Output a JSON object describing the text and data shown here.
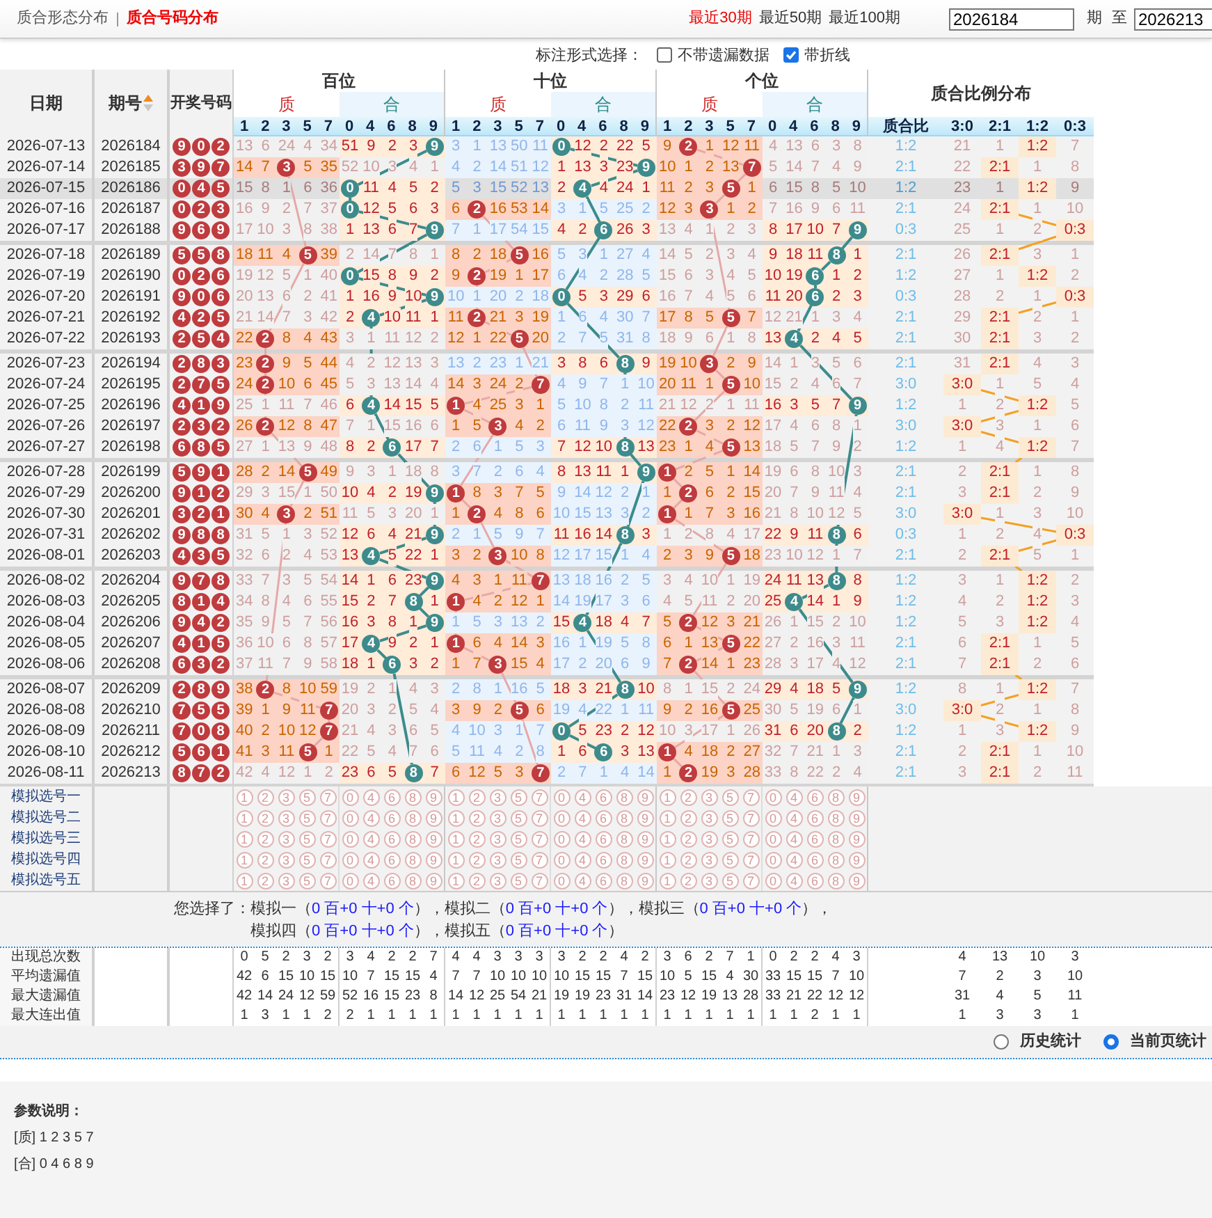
{
  "top_bar": {
    "tabs": [
      {
        "label": "质合形态分布",
        "selected": false
      },
      {
        "label": "质合号码分布",
        "selected": true
      }
    ],
    "periods": [
      {
        "label": "最近30期",
        "selected": true
      },
      {
        "label": "最近50期",
        "selected": false
      },
      {
        "label": "最近100期",
        "selected": false
      }
    ],
    "from_value": "2026184",
    "from_unit": "期",
    "to_label": "至",
    "to_value": "2026213"
  },
  "options": {
    "label": "标注形式选择：",
    "checkboxes": [
      {
        "label": "不带遗漏数据",
        "checked": false
      },
      {
        "label": "带折线",
        "checked": true
      }
    ]
  },
  "header": {
    "date": "日期",
    "issue": "期号",
    "draw": "开奖号码",
    "positions": [
      {
        "label": "百位",
        "groups": [
          {
            "label": "质",
            "kind": "prime",
            "digits": [
              "1",
              "2",
              "3",
              "5",
              "7"
            ]
          },
          {
            "label": "合",
            "kind": "composite",
            "digits": [
              "0",
              "4",
              "6",
              "8",
              "9"
            ]
          }
        ]
      },
      {
        "label": "十位",
        "groups": [
          {
            "label": "质",
            "kind": "prime",
            "digits": [
              "1",
              "2",
              "3",
              "5",
              "7"
            ]
          },
          {
            "label": "合",
            "kind": "composite",
            "digits": [
              "0",
              "4",
              "6",
              "8",
              "9"
            ]
          }
        ]
      },
      {
        "label": "个位",
        "groups": [
          {
            "label": "质",
            "kind": "prime",
            "digits": [
              "1",
              "2",
              "3",
              "5",
              "7"
            ]
          },
          {
            "label": "合",
            "kind": "composite",
            "digits": [
              "0",
              "4",
              "6",
              "8",
              "9"
            ]
          }
        ]
      }
    ],
    "ratio": {
      "label": "质合比例分布",
      "columns": [
        "质合比",
        "3:0",
        "2:1",
        "1:2",
        "0:3"
      ]
    }
  },
  "rows": [
    {
      "date": "2026-07-13",
      "issue": "2026184",
      "draw": [
        "9",
        "0",
        "2"
      ],
      "highlighted": false,
      "cells": [
        "13",
        "6",
        "24",
        "4",
        "34",
        "51",
        "9",
        "2",
        "3",
        {
          "ball": "9"
        },
        "3",
        "1",
        "13",
        "50",
        "11",
        {
          "ball": "0"
        },
        "12",
        "2",
        "22",
        "5",
        "9",
        {
          "ball": "2"
        },
        "1",
        "12",
        "11",
        "4",
        "13",
        "6",
        "3",
        "8"
      ],
      "ratio": "1:2",
      "ratio_cells": [
        "21",
        "1",
        {
          "hit": "1:2"
        },
        "7"
      ]
    },
    {
      "date": "2026-07-14",
      "issue": "2026185",
      "draw": [
        "3",
        "9",
        "7"
      ],
      "highlighted": false,
      "cells": [
        "14",
        "7",
        {
          "ball": "3"
        },
        "5",
        "35",
        "52",
        "10",
        "3",
        "4",
        "1",
        "4",
        "2",
        "14",
        "51",
        "12",
        "1",
        "13",
        "3",
        "23",
        {
          "ball": "9"
        },
        "10",
        "1",
        "2",
        "13",
        {
          "ball": "7"
        },
        "5",
        "14",
        "7",
        "4",
        "9"
      ],
      "ratio": "2:1",
      "ratio_cells": [
        "22",
        {
          "hit": "2:1"
        },
        "1",
        "8"
      ]
    },
    {
      "date": "2026-07-15",
      "issue": "2026186",
      "draw": [
        "0",
        "4",
        "5"
      ],
      "highlighted": true,
      "cells": [
        "15",
        "8",
        "1",
        "6",
        "36",
        {
          "ball": "0"
        },
        "11",
        "4",
        "5",
        "2",
        "5",
        "3",
        "15",
        "52",
        "13",
        "2",
        {
          "ball": "4"
        },
        "4",
        "24",
        "1",
        "11",
        "2",
        "3",
        {
          "ball": "5"
        },
        "1",
        "6",
        "15",
        "8",
        "5",
        "10"
      ],
      "ratio": "1:2",
      "ratio_cells": [
        "23",
        "1",
        {
          "hit": "1:2"
        },
        "9"
      ]
    },
    {
      "date": "2026-07-16",
      "issue": "2026187",
      "draw": [
        "0",
        "2",
        "3"
      ],
      "highlighted": false,
      "cells": [
        "16",
        "9",
        "2",
        "7",
        "37",
        {
          "ball": "0"
        },
        "12",
        "5",
        "6",
        "3",
        "6",
        {
          "ball": "2"
        },
        "16",
        "53",
        "14",
        "3",
        "1",
        "5",
        "25",
        "2",
        "12",
        "3",
        {
          "ball": "3"
        },
        "1",
        "2",
        "7",
        "16",
        "9",
        "6",
        "11"
      ],
      "ratio": "2:1",
      "ratio_cells": [
        "24",
        {
          "hit": "2:1"
        },
        "1",
        "10"
      ]
    },
    {
      "date": "2026-07-17",
      "issue": "2026188",
      "draw": [
        "9",
        "6",
        "9"
      ],
      "highlighted": false,
      "cells": [
        "17",
        "10",
        "3",
        "8",
        "38",
        "1",
        "13",
        "6",
        "7",
        {
          "ball": "9"
        },
        "7",
        "1",
        "17",
        "54",
        "15",
        "4",
        "2",
        {
          "ball": "6"
        },
        "26",
        "3",
        "13",
        "4",
        "1",
        "2",
        "3",
        "8",
        "17",
        "10",
        "7",
        {
          "ball": "9"
        }
      ],
      "ratio": "0:3",
      "ratio_cells": [
        "25",
        "1",
        "2",
        {
          "hit": "0:3"
        }
      ]
    },
    {
      "date": "2026-07-18",
      "issue": "2026189",
      "draw": [
        "5",
        "5",
        "8"
      ],
      "highlighted": false,
      "cells": [
        "18",
        "11",
        "4",
        {
          "ball": "5"
        },
        "39",
        "2",
        "14",
        "7",
        "8",
        "1",
        "8",
        "2",
        "18",
        {
          "ball": "5"
        },
        "16",
        "5",
        "3",
        "1",
        "27",
        "4",
        "14",
        "5",
        "2",
        "3",
        "4",
        "9",
        "18",
        "11",
        {
          "ball": "8"
        },
        "1"
      ],
      "ratio": "2:1",
      "ratio_cells": [
        "26",
        {
          "hit": "2:1"
        },
        "3",
        "1"
      ]
    },
    {
      "date": "2026-07-19",
      "issue": "2026190",
      "draw": [
        "0",
        "2",
        "6"
      ],
      "highlighted": false,
      "cells": [
        "19",
        "12",
        "5",
        "1",
        "40",
        {
          "ball": "0"
        },
        "15",
        "8",
        "9",
        "2",
        "9",
        {
          "ball": "2"
        },
        "19",
        "1",
        "17",
        "6",
        "4",
        "2",
        "28",
        "5",
        "15",
        "6",
        "3",
        "4",
        "5",
        "10",
        "19",
        {
          "ball": "6"
        },
        "1",
        "2"
      ],
      "ratio": "1:2",
      "ratio_cells": [
        "27",
        "1",
        {
          "hit": "1:2"
        },
        "2"
      ]
    },
    {
      "date": "2026-07-20",
      "issue": "2026191",
      "draw": [
        "9",
        "0",
        "6"
      ],
      "highlighted": false,
      "cells": [
        "20",
        "13",
        "6",
        "2",
        "41",
        "1",
        "16",
        "9",
        "10",
        {
          "ball": "9"
        },
        "10",
        "1",
        "20",
        "2",
        "18",
        {
          "ball": "0"
        },
        "5",
        "3",
        "29",
        "6",
        "16",
        "7",
        "4",
        "5",
        "6",
        "11",
        "20",
        {
          "ball": "6"
        },
        "2",
        "3"
      ],
      "ratio": "0:3",
      "ratio_cells": [
        "28",
        "2",
        "1",
        {
          "hit": "0:3"
        }
      ]
    },
    {
      "date": "2026-07-21",
      "issue": "2026192",
      "draw": [
        "4",
        "2",
        "5"
      ],
      "highlighted": false,
      "cells": [
        "21",
        "14",
        "7",
        "3",
        "42",
        "2",
        {
          "ball": "4"
        },
        "10",
        "11",
        "1",
        "11",
        {
          "ball": "2"
        },
        "21",
        "3",
        "19",
        "1",
        "6",
        "4",
        "30",
        "7",
        "17",
        "8",
        "5",
        {
          "ball": "5"
        },
        "7",
        "12",
        "21",
        "1",
        "3",
        "4"
      ],
      "ratio": "2:1",
      "ratio_cells": [
        "29",
        {
          "hit": "2:1"
        },
        "2",
        "1"
      ]
    },
    {
      "date": "2026-07-22",
      "issue": "2026193",
      "draw": [
        "2",
        "5",
        "4"
      ],
      "highlighted": false,
      "cells": [
        "22",
        {
          "ball": "2"
        },
        "8",
        "4",
        "43",
        "3",
        "1",
        "11",
        "12",
        "2",
        "12",
        "1",
        "22",
        {
          "ball": "5"
        },
        "20",
        "2",
        "7",
        "5",
        "31",
        "8",
        "18",
        "9",
        "6",
        "1",
        "8",
        "13",
        {
          "ball": "4"
        },
        "2",
        "4",
        "5"
      ],
      "ratio": "2:1",
      "ratio_cells": [
        "30",
        {
          "hit": "2:1"
        },
        "3",
        "2"
      ]
    },
    {
      "date": "2026-07-23",
      "issue": "2026194",
      "draw": [
        "2",
        "8",
        "3"
      ],
      "highlighted": false,
      "cells": [
        "23",
        {
          "ball": "2"
        },
        "9",
        "5",
        "44",
        "4",
        "2",
        "12",
        "13",
        "3",
        "13",
        "2",
        "23",
        "1",
        "21",
        "3",
        "8",
        "6",
        {
          "ball": "8"
        },
        "9",
        "19",
        "10",
        {
          "ball": "3"
        },
        "2",
        "9",
        "14",
        "1",
        "3",
        "5",
        "6"
      ],
      "ratio": "2:1",
      "ratio_cells": [
        "31",
        {
          "hit": "2:1"
        },
        "4",
        "3"
      ]
    },
    {
      "date": "2026-07-24",
      "issue": "2026195",
      "draw": [
        "2",
        "7",
        "5"
      ],
      "highlighted": false,
      "cells": [
        "24",
        {
          "ball": "2"
        },
        "10",
        "6",
        "45",
        "5",
        "3",
        "13",
        "14",
        "4",
        "14",
        "3",
        "24",
        "2",
        {
          "ball": "7"
        },
        "4",
        "9",
        "7",
        "1",
        "10",
        "20",
        "11",
        "1",
        {
          "ball": "5"
        },
        "10",
        "15",
        "2",
        "4",
        "6",
        "7"
      ],
      "ratio": "3:0",
      "ratio_cells": [
        {
          "hit": "3:0"
        },
        "1",
        "5",
        "4"
      ]
    },
    {
      "date": "2026-07-25",
      "issue": "2026196",
      "draw": [
        "4",
        "1",
        "9"
      ],
      "highlighted": false,
      "cells": [
        "25",
        "1",
        "11",
        "7",
        "46",
        "6",
        {
          "ball": "4"
        },
        "14",
        "15",
        "5",
        {
          "ball": "1"
        },
        "4",
        "25",
        "3",
        "1",
        "5",
        "10",
        "8",
        "2",
        "11",
        "21",
        "12",
        "2",
        "1",
        "11",
        "16",
        "3",
        "5",
        "7",
        {
          "ball": "9"
        }
      ],
      "ratio": "1:2",
      "ratio_cells": [
        "1",
        "2",
        {
          "hit": "1:2"
        },
        "5"
      ]
    },
    {
      "date": "2026-07-26",
      "issue": "2026197",
      "draw": [
        "2",
        "3",
        "2"
      ],
      "highlighted": false,
      "cells": [
        "26",
        {
          "ball": "2"
        },
        "12",
        "8",
        "47",
        "7",
        "1",
        "15",
        "16",
        "6",
        "1",
        "5",
        {
          "ball": "3"
        },
        "4",
        "2",
        "6",
        "11",
        "9",
        "3",
        "12",
        "22",
        {
          "ball": "2"
        },
        "3",
        "2",
        "12",
        "17",
        "4",
        "6",
        "8",
        "1"
      ],
      "ratio": "3:0",
      "ratio_cells": [
        {
          "hit": "3:0"
        },
        "3",
        "1",
        "6"
      ]
    },
    {
      "date": "2026-07-27",
      "issue": "2026198",
      "draw": [
        "6",
        "8",
        "5"
      ],
      "highlighted": false,
      "cells": [
        "27",
        "1",
        "13",
        "9",
        "48",
        "8",
        "2",
        {
          "ball": "6"
        },
        "17",
        "7",
        "2",
        "6",
        "1",
        "5",
        "3",
        "7",
        "12",
        "10",
        {
          "ball": "8"
        },
        "13",
        "23",
        "1",
        "4",
        {
          "ball": "5"
        },
        "13",
        "18",
        "5",
        "7",
        "9",
        "2"
      ],
      "ratio": "1:2",
      "ratio_cells": [
        "1",
        "4",
        {
          "hit": "1:2"
        },
        "7"
      ]
    },
    {
      "date": "2026-07-28",
      "issue": "2026199",
      "draw": [
        "5",
        "9",
        "1"
      ],
      "highlighted": false,
      "cells": [
        "28",
        "2",
        "14",
        {
          "ball": "5"
        },
        "49",
        "9",
        "3",
        "1",
        "18",
        "8",
        "3",
        "7",
        "2",
        "6",
        "4",
        "8",
        "13",
        "11",
        "1",
        {
          "ball": "9"
        },
        {
          "ball": "1"
        },
        "2",
        "5",
        "1",
        "14",
        "19",
        "6",
        "8",
        "10",
        "3"
      ],
      "ratio": "2:1",
      "ratio_cells": [
        "2",
        {
          "hit": "2:1"
        },
        "1",
        "8"
      ]
    },
    {
      "date": "2026-07-29",
      "issue": "2026200",
      "draw": [
        "9",
        "1",
        "2"
      ],
      "highlighted": false,
      "cells": [
        "29",
        "3",
        "15",
        "1",
        "50",
        "10",
        "4",
        "2",
        "19",
        {
          "ball": "9"
        },
        {
          "ball": "1"
        },
        "8",
        "3",
        "7",
        "5",
        "9",
        "14",
        "12",
        "2",
        "1",
        "1",
        {
          "ball": "2"
        },
        "6",
        "2",
        "15",
        "20",
        "7",
        "9",
        "11",
        "4"
      ],
      "ratio": "2:1",
      "ratio_cells": [
        "3",
        {
          "hit": "2:1"
        },
        "2",
        "9"
      ]
    },
    {
      "date": "2026-07-30",
      "issue": "2026201",
      "draw": [
        "3",
        "2",
        "1"
      ],
      "highlighted": false,
      "cells": [
        "30",
        "4",
        {
          "ball": "3"
        },
        "2",
        "51",
        "11",
        "5",
        "3",
        "20",
        "1",
        "1",
        {
          "ball": "2"
        },
        "4",
        "8",
        "6",
        "10",
        "15",
        "13",
        "3",
        "2",
        {
          "ball": "1"
        },
        "1",
        "7",
        "3",
        "16",
        "21",
        "8",
        "10",
        "12",
        "5"
      ],
      "ratio": "3:0",
      "ratio_cells": [
        {
          "hit": "3:0"
        },
        "1",
        "3",
        "10"
      ]
    },
    {
      "date": "2026-07-31",
      "issue": "2026202",
      "draw": [
        "9",
        "8",
        "8"
      ],
      "highlighted": false,
      "cells": [
        "31",
        "5",
        "1",
        "3",
        "52",
        "12",
        "6",
        "4",
        "21",
        {
          "ball": "9"
        },
        "2",
        "1",
        "5",
        "9",
        "7",
        "11",
        "16",
        "14",
        {
          "ball": "8"
        },
        "3",
        "1",
        "2",
        "8",
        "4",
        "17",
        "22",
        "9",
        "11",
        {
          "ball": "8"
        },
        "6"
      ],
      "ratio": "0:3",
      "ratio_cells": [
        "1",
        "2",
        "4",
        {
          "hit": "0:3"
        }
      ]
    },
    {
      "date": "2026-08-01",
      "issue": "2026203",
      "draw": [
        "4",
        "3",
        "5"
      ],
      "highlighted": false,
      "cells": [
        "32",
        "6",
        "2",
        "4",
        "53",
        "13",
        {
          "ball": "4"
        },
        "5",
        "22",
        "1",
        "3",
        "2",
        {
          "ball": "3"
        },
        "10",
        "8",
        "12",
        "17",
        "15",
        "1",
        "4",
        "2",
        "3",
        "9",
        {
          "ball": "5"
        },
        "18",
        "23",
        "10",
        "12",
        "1",
        "7"
      ],
      "ratio": "2:1",
      "ratio_cells": [
        "2",
        {
          "hit": "2:1"
        },
        "5",
        "1"
      ]
    },
    {
      "date": "2026-08-02",
      "issue": "2026204",
      "draw": [
        "9",
        "7",
        "8"
      ],
      "highlighted": false,
      "cells": [
        "33",
        "7",
        "3",
        "5",
        "54",
        "14",
        "1",
        "6",
        "23",
        {
          "ball": "9"
        },
        "4",
        "3",
        "1",
        "11",
        {
          "ball": "7"
        },
        "13",
        "18",
        "16",
        "2",
        "5",
        "3",
        "4",
        "10",
        "1",
        "19",
        "24",
        "11",
        "13",
        {
          "ball": "8"
        },
        "8"
      ],
      "ratio": "1:2",
      "ratio_cells": [
        "3",
        "1",
        {
          "hit": "1:2"
        },
        "2"
      ]
    },
    {
      "date": "2026-08-03",
      "issue": "2026205",
      "draw": [
        "8",
        "1",
        "4"
      ],
      "highlighted": false,
      "cells": [
        "34",
        "8",
        "4",
        "6",
        "55",
        "15",
        "2",
        "7",
        {
          "ball": "8"
        },
        "1",
        {
          "ball": "1"
        },
        "4",
        "2",
        "12",
        "1",
        "14",
        "19",
        "17",
        "3",
        "6",
        "4",
        "5",
        "11",
        "2",
        "20",
        "25",
        {
          "ball": "4"
        },
        "14",
        "1",
        "9"
      ],
      "ratio": "1:2",
      "ratio_cells": [
        "4",
        "2",
        {
          "hit": "1:2"
        },
        "3"
      ]
    },
    {
      "date": "2026-08-04",
      "issue": "2026206",
      "draw": [
        "9",
        "4",
        "2"
      ],
      "highlighted": false,
      "cells": [
        "35",
        "9",
        "5",
        "7",
        "56",
        "16",
        "3",
        "8",
        "1",
        {
          "ball": "9"
        },
        "1",
        "5",
        "3",
        "13",
        "2",
        "15",
        {
          "ball": "4"
        },
        "18",
        "4",
        "7",
        "5",
        {
          "ball": "2"
        },
        "12",
        "3",
        "21",
        "26",
        "1",
        "15",
        "2",
        "10"
      ],
      "ratio": "1:2",
      "ratio_cells": [
        "5",
        "3",
        {
          "hit": "1:2"
        },
        "4"
      ]
    },
    {
      "date": "2026-08-05",
      "issue": "2026207",
      "draw": [
        "4",
        "1",
        "5"
      ],
      "highlighted": false,
      "cells": [
        "36",
        "10",
        "6",
        "8",
        "57",
        "17",
        {
          "ball": "4"
        },
        "9",
        "2",
        "1",
        {
          "ball": "1"
        },
        "6",
        "4",
        "14",
        "3",
        "16",
        "1",
        "19",
        "5",
        "8",
        "6",
        "1",
        "13",
        {
          "ball": "5"
        },
        "22",
        "27",
        "2",
        "16",
        "3",
        "11"
      ],
      "ratio": "2:1",
      "ratio_cells": [
        "6",
        {
          "hit": "2:1"
        },
        "1",
        "5"
      ]
    },
    {
      "date": "2026-08-06",
      "issue": "2026208",
      "draw": [
        "6",
        "3",
        "2"
      ],
      "highlighted": false,
      "cells": [
        "37",
        "11",
        "7",
        "9",
        "58",
        "18",
        "1",
        {
          "ball": "6"
        },
        "3",
        "2",
        "1",
        "7",
        {
          "ball": "3"
        },
        "15",
        "4",
        "17",
        "2",
        "20",
        "6",
        "9",
        "7",
        {
          "ball": "2"
        },
        "14",
        "1",
        "23",
        "28",
        "3",
        "17",
        "4",
        "12"
      ],
      "ratio": "2:1",
      "ratio_cells": [
        "7",
        {
          "hit": "2:1"
        },
        "2",
        "6"
      ]
    },
    {
      "date": "2026-08-07",
      "issue": "2026209",
      "draw": [
        "2",
        "8",
        "9"
      ],
      "highlighted": false,
      "cells": [
        "38",
        {
          "ball": "2"
        },
        "8",
        "10",
        "59",
        "19",
        "2",
        "1",
        "4",
        "3",
        "2",
        "8",
        "1",
        "16",
        "5",
        "18",
        "3",
        "21",
        {
          "ball": "8"
        },
        "10",
        "8",
        "1",
        "15",
        "2",
        "24",
        "29",
        "4",
        "18",
        "5",
        {
          "ball": "9"
        }
      ],
      "ratio": "1:2",
      "ratio_cells": [
        "8",
        "1",
        {
          "hit": "1:2"
        },
        "7"
      ]
    },
    {
      "date": "2026-08-08",
      "issue": "2026210",
      "draw": [
        "7",
        "5",
        "5"
      ],
      "highlighted": false,
      "cells": [
        "39",
        "1",
        "9",
        "11",
        {
          "ball": "7"
        },
        "20",
        "3",
        "2",
        "5",
        "4",
        "3",
        "9",
        "2",
        {
          "ball": "5"
        },
        "6",
        "19",
        "4",
        "22",
        "1",
        "11",
        "9",
        "2",
        "16",
        {
          "ball": "5"
        },
        "25",
        "30",
        "5",
        "19",
        "6",
        "1"
      ],
      "ratio": "3:0",
      "ratio_cells": [
        {
          "hit": "3:0"
        },
        "2",
        "1",
        "8"
      ]
    },
    {
      "date": "2026-08-09",
      "issue": "2026211",
      "draw": [
        "7",
        "0",
        "8"
      ],
      "highlighted": false,
      "cells": [
        "40",
        "2",
        "10",
        "12",
        {
          "ball": "7"
        },
        "21",
        "4",
        "3",
        "6",
        "5",
        "4",
        "10",
        "3",
        "1",
        "7",
        {
          "ball": "0"
        },
        "5",
        "23",
        "2",
        "12",
        "10",
        "3",
        "17",
        "1",
        "26",
        "31",
        "6",
        "20",
        {
          "ball": "8"
        },
        "2"
      ],
      "ratio": "1:2",
      "ratio_cells": [
        "1",
        "3",
        {
          "hit": "1:2"
        },
        "9"
      ]
    },
    {
      "date": "2026-08-10",
      "issue": "2026212",
      "draw": [
        "5",
        "6",
        "1"
      ],
      "highlighted": false,
      "cells": [
        "41",
        "3",
        "11",
        {
          "ball": "5"
        },
        "1",
        "22",
        "5",
        "4",
        "7",
        "6",
        "5",
        "11",
        "4",
        "2",
        "8",
        "1",
        "6",
        {
          "ball": "6"
        },
        "3",
        "13",
        {
          "ball": "1"
        },
        "4",
        "18",
        "2",
        "27",
        "32",
        "7",
        "21",
        "1",
        "3"
      ],
      "ratio": "2:1",
      "ratio_cells": [
        "2",
        {
          "hit": "2:1"
        },
        "1",
        "10"
      ]
    },
    {
      "date": "2026-08-11",
      "issue": "2026213",
      "draw": [
        "8",
        "7",
        "2"
      ],
      "highlighted": false,
      "cells": [
        "42",
        "4",
        "12",
        "1",
        "2",
        "23",
        "6",
        "5",
        {
          "ball": "8"
        },
        "7",
        "6",
        "12",
        "5",
        "3",
        {
          "ball": "7"
        },
        "2",
        "7",
        "1",
        "4",
        "14",
        "1",
        {
          "ball": "2"
        },
        "19",
        "3",
        "28",
        "33",
        "8",
        "22",
        "2",
        "4"
      ],
      "ratio": "2:1",
      "ratio_cells": [
        "3",
        {
          "hit": "2:1"
        },
        "2",
        "11"
      ]
    }
  ],
  "simulation": {
    "rows": [
      {
        "label": "模拟选号一",
        "digits": [
          "1",
          "2",
          "3",
          "5",
          "7",
          "0",
          "4",
          "6",
          "8",
          "9",
          "1",
          "2",
          "3",
          "5",
          "7",
          "0",
          "4",
          "6",
          "8",
          "9",
          "1",
          "2",
          "3",
          "5",
          "7",
          "0",
          "4",
          "6",
          "8",
          "9"
        ]
      },
      {
        "label": "模拟选号二",
        "digits": [
          "1",
          "2",
          "3",
          "5",
          "7",
          "0",
          "4",
          "6",
          "8",
          "9",
          "1",
          "2",
          "3",
          "5",
          "7",
          "0",
          "4",
          "6",
          "8",
          "9",
          "1",
          "2",
          "3",
          "5",
          "7",
          "0",
          "4",
          "6",
          "8",
          "9"
        ]
      },
      {
        "label": "模拟选号三",
        "digits": [
          "1",
          "2",
          "3",
          "5",
          "7",
          "0",
          "4",
          "6",
          "8",
          "9",
          "1",
          "2",
          "3",
          "5",
          "7",
          "0",
          "4",
          "6",
          "8",
          "9",
          "1",
          "2",
          "3",
          "5",
          "7",
          "0",
          "4",
          "6",
          "8",
          "9"
        ]
      },
      {
        "label": "模拟选号四",
        "digits": [
          "1",
          "2",
          "3",
          "5",
          "7",
          "0",
          "4",
          "6",
          "8",
          "9",
          "1",
          "2",
          "3",
          "5",
          "7",
          "0",
          "4",
          "6",
          "8",
          "9",
          "1",
          "2",
          "3",
          "5",
          "7",
          "0",
          "4",
          "6",
          "8",
          "9"
        ]
      },
      {
        "label": "模拟选号五",
        "digits": [
          "1",
          "2",
          "3",
          "5",
          "7",
          "0",
          "4",
          "6",
          "8",
          "9",
          "1",
          "2",
          "3",
          "5",
          "7",
          "0",
          "4",
          "6",
          "8",
          "9",
          "1",
          "2",
          "3",
          "5",
          "7",
          "0",
          "4",
          "6",
          "8",
          "9"
        ]
      }
    ],
    "summary_label": "您选择了：",
    "summary_lines": [
      [
        {
          "text": "模拟一（",
          "kind": "plain"
        },
        {
          "text": "0 百+0 十+0 个",
          "kind": "value"
        },
        {
          "text": "），模拟二（",
          "kind": "plain"
        },
        {
          "text": "0 百+0 十+0 个",
          "kind": "value"
        },
        {
          "text": "），模拟三（",
          "kind": "plain"
        },
        {
          "text": "0 百+0 十+0 个",
          "kind": "value"
        },
        {
          "text": "），",
          "kind": "plain"
        }
      ],
      [
        {
          "text": "模拟四（",
          "kind": "plain"
        },
        {
          "text": "0 百+0 十+0 个",
          "kind": "value"
        },
        {
          "text": "），模拟五（",
          "kind": "plain"
        },
        {
          "text": "0 百+0 十+0 个",
          "kind": "value"
        },
        {
          "text": "）",
          "kind": "plain"
        }
      ]
    ]
  },
  "stats": [
    {
      "label": "出现总次数",
      "values": [
        "0",
        "5",
        "2",
        "3",
        "2",
        "3",
        "4",
        "2",
        "2",
        "7",
        "4",
        "4",
        "3",
        "3",
        "3",
        "3",
        "2",
        "2",
        "4",
        "2",
        "3",
        "6",
        "2",
        "7",
        "1",
        "0",
        "2",
        "2",
        "4",
        "3"
      ],
      "ratio_values": [
        "4",
        "13",
        "10",
        "3"
      ]
    },
    {
      "label": "平均遗漏值",
      "values": [
        "42",
        "6",
        "15",
        "10",
        "15",
        "10",
        "7",
        "15",
        "15",
        "4",
        "7",
        "7",
        "10",
        "10",
        "10",
        "10",
        "15",
        "15",
        "7",
        "15",
        "10",
        "5",
        "15",
        "4",
        "30",
        "33",
        "15",
        "15",
        "7",
        "10"
      ],
      "ratio_values": [
        "7",
        "2",
        "3",
        "10"
      ]
    },
    {
      "label": "最大遗漏值",
      "values": [
        "42",
        "14",
        "24",
        "12",
        "59",
        "52",
        "16",
        "15",
        "23",
        "8",
        "14",
        "12",
        "25",
        "54",
        "21",
        "19",
        "19",
        "23",
        "31",
        "14",
        "23",
        "12",
        "19",
        "13",
        "28",
        "33",
        "21",
        "22",
        "12",
        "12"
      ],
      "ratio_values": [
        "31",
        "4",
        "5",
        "11"
      ]
    },
    {
      "label": "最大连出值",
      "values": [
        "1",
        "3",
        "1",
        "1",
        "2",
        "2",
        "1",
        "1",
        "1",
        "1",
        "1",
        "1",
        "1",
        "1",
        "1",
        "1",
        "1",
        "1",
        "1",
        "1",
        "1",
        "1",
        "1",
        "1",
        "1",
        "1",
        "1",
        "2",
        "1",
        "1"
      ],
      "ratio_values": [
        "1",
        "3",
        "3",
        "1"
      ]
    }
  ],
  "stat_modes": [
    {
      "label": "历史统计",
      "selected": false
    },
    {
      "label": "当前页统计",
      "selected": true
    }
  ],
  "notes": {
    "title": "参数说明：",
    "lines": [
      "[质] 1 2 3 5 7",
      "[合] 0 4 6 8 9"
    ]
  }
}
